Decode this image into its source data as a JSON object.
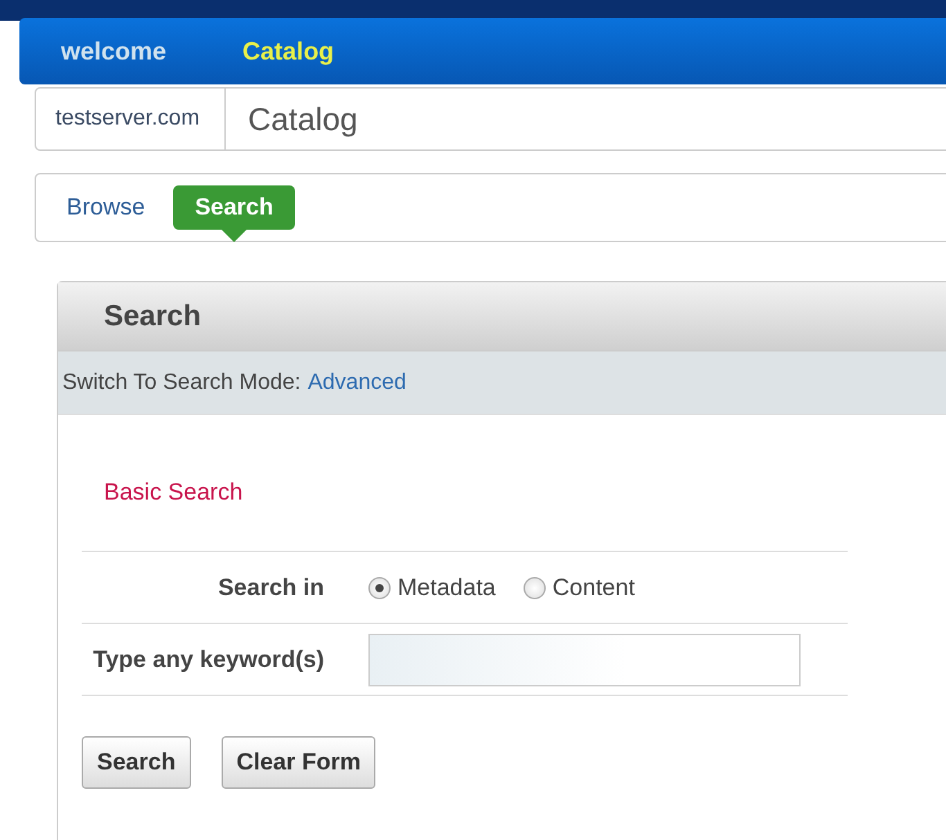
{
  "top_nav": [
    {
      "label": "welcome",
      "selected": false
    },
    {
      "label": "Catalog",
      "selected": true
    }
  ],
  "breadcrumb": {
    "root": "testserver.com",
    "current": "Catalog"
  },
  "sub_nav": [
    {
      "label": "Browse",
      "selected": false
    },
    {
      "label": "Search",
      "selected": true
    }
  ],
  "panel": {
    "title": "Search",
    "mode_label": "Switch To Search Mode:",
    "mode_link": "Advanced",
    "section_title": "Basic Search",
    "search_in": {
      "label": "Search in",
      "options": [
        {
          "label": "Metadata",
          "selected": true
        },
        {
          "label": "Content",
          "selected": false
        }
      ]
    },
    "keyword": {
      "label": "Type any keyword(s)"
    },
    "buttons": [
      "Search",
      "Clear Form"
    ]
  }
}
